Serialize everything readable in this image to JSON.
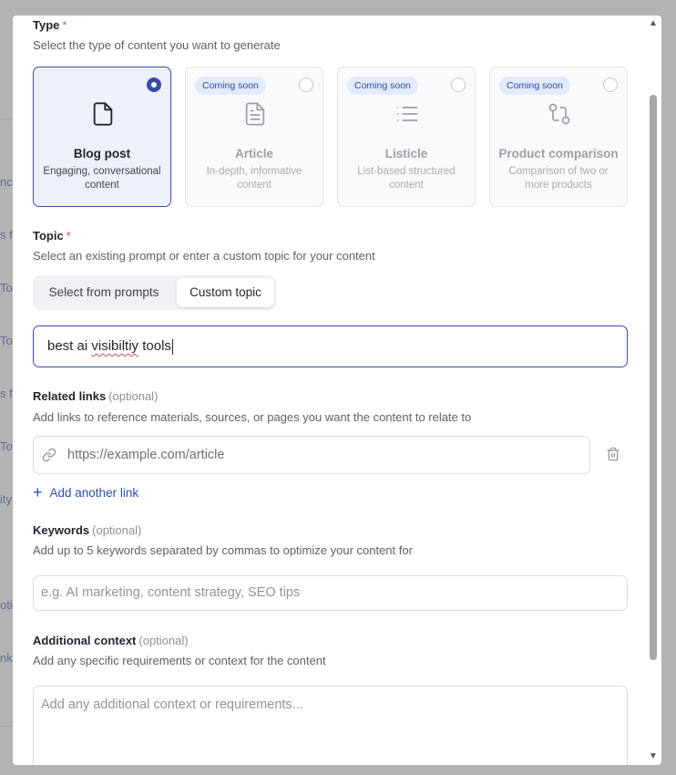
{
  "background": {
    "fragments": [
      "nch",
      "s fo",
      "To",
      "To",
      "s fo",
      "Too",
      "ity",
      "oti",
      "nk"
    ]
  },
  "type_section": {
    "label": "Type",
    "required_mark": "*",
    "help": "Select the type of content you want to generate",
    "options": [
      {
        "title": "Blog post",
        "desc": "Engaging, conversational content",
        "badge": "",
        "selected": true,
        "icon": "file-icon"
      },
      {
        "title": "Article",
        "desc": "In-depth, informative content",
        "badge": "Coming soon",
        "selected": false,
        "icon": "file-text-icon"
      },
      {
        "title": "Listicle",
        "desc": "List-based structured content",
        "badge": "Coming soon",
        "selected": false,
        "icon": "list-icon"
      },
      {
        "title": "Product comparison",
        "desc": "Comparison of two or more products",
        "badge": "Coming soon",
        "selected": false,
        "icon": "git-compare-icon"
      }
    ]
  },
  "topic_section": {
    "label": "Topic",
    "required_mark": "*",
    "help": "Select an existing prompt or enter a custom topic for your content",
    "tabs": [
      "Select from prompts",
      "Custom topic"
    ],
    "active_tab": "Custom topic",
    "input_value_prefix": "best ai ",
    "input_value_misspelled": "visibiltiy",
    "input_value_suffix": " tools"
  },
  "links_section": {
    "label": "Related links",
    "optional": "(optional)",
    "help": "Add links to reference materials, sources, or pages you want the content to relate to",
    "placeholder": "https://example.com/article",
    "add_label": "Add another link"
  },
  "keywords_section": {
    "label": "Keywords",
    "optional": "(optional)",
    "help": "Add up to 5 keywords separated by commas to optimize your content for",
    "placeholder": "e.g. AI marketing, content strategy, SEO tips"
  },
  "context_section": {
    "label": "Additional context",
    "optional": "(optional)",
    "help": "Add any specific requirements or context for the content",
    "placeholder": "Add any additional context or requirements..."
  },
  "colors": {
    "accent": "#3b4ba8",
    "link": "#2d4fb5",
    "required": "#e5484d",
    "badge_bg": "#e3ebfb"
  }
}
